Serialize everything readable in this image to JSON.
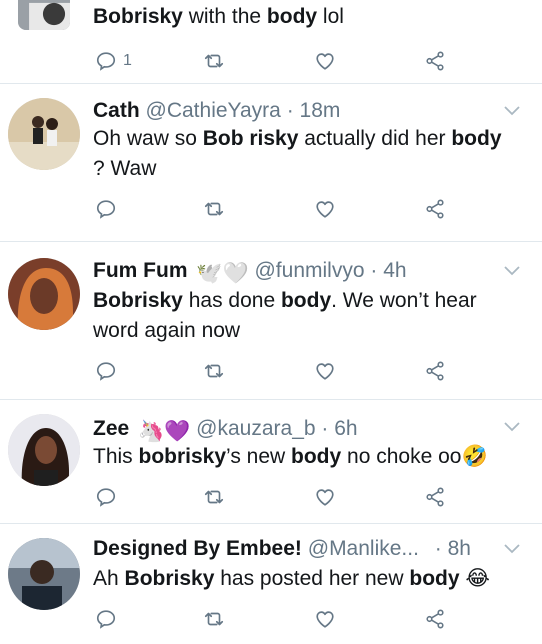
{
  "tweets": [
    {
      "name": "",
      "handle": "",
      "time": "",
      "body_segments": [
        {
          "text": "Bobrisky",
          "bold": true
        },
        {
          "text": " with the ",
          "bold": false
        },
        {
          "text": "body",
          "bold": true
        },
        {
          "text": " lol",
          "bold": false
        }
      ],
      "reply_count": "1"
    },
    {
      "name": "Cath",
      "handle": "@CathieYayra",
      "time": "18m",
      "body_segments": [
        {
          "text": "Oh waw so ",
          "bold": false
        },
        {
          "text": "Bob risky",
          "bold": true
        },
        {
          "text": " actually did her ",
          "bold": false
        },
        {
          "text": "body",
          "bold": true
        },
        {
          "text": " ? Waw",
          "bold": false
        }
      ],
      "reply_count": ""
    },
    {
      "name": "Fum Fum",
      "name_emoji": "🕊️🤍",
      "handle": "@funmilvyo",
      "time": "4h",
      "body_segments": [
        {
          "text": "Bobrisky",
          "bold": true
        },
        {
          "text": " has done ",
          "bold": false
        },
        {
          "text": "body",
          "bold": true
        },
        {
          "text": ". We won’t hear word again now",
          "bold": false
        }
      ],
      "reply_count": ""
    },
    {
      "name": "Zee",
      "name_emoji": "🦄💜",
      "handle": "@kauzara_b",
      "time": "6h",
      "body_segments": [
        {
          "text": "This ",
          "bold": false
        },
        {
          "text": "bobrisky",
          "bold": true
        },
        {
          "text": "’s new ",
          "bold": false
        },
        {
          "text": "body",
          "bold": true
        },
        {
          "text": " no choke oo🤣",
          "bold": false
        }
      ],
      "reply_count": ""
    },
    {
      "name": "Designed By Embee!",
      "handle": "@Manlike...",
      "time": "8h",
      "body_segments": [
        {
          "text": "Ah ",
          "bold": false
        },
        {
          "text": "Bobrisky",
          "bold": true
        },
        {
          "text": " has posted her new ",
          "bold": false
        },
        {
          "text": "body",
          "bold": true
        },
        {
          "text": " 😂",
          "bold": false
        }
      ],
      "reply_count": ""
    }
  ],
  "separator": "·",
  "colors": {
    "text": "#14171a",
    "secondary": "#657786",
    "divider": "#e1e8ed",
    "icon": "#657786"
  },
  "icons": [
    "reply-icon",
    "retweet-icon",
    "like-icon",
    "share-icon",
    "chevron-down-icon"
  ]
}
